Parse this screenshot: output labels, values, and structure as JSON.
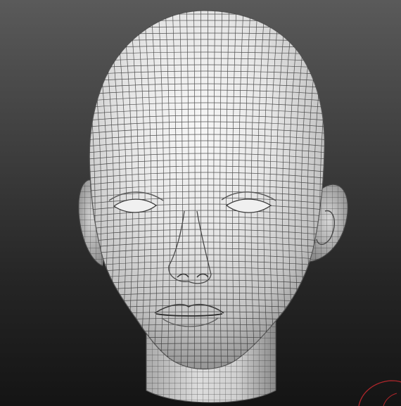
{
  "viewport": {
    "background_top": "#5a5a5a",
    "background_bottom": "#141414"
  },
  "model": {
    "subject": "head-wireframe-mesh",
    "surface_color": "#e9e9e9",
    "shadow_color": "#9a9a9a",
    "wire_color": "#2b2b2b"
  },
  "gizmo": {
    "icon": "orientation-gizmo-icon",
    "color": "#b0262b"
  }
}
